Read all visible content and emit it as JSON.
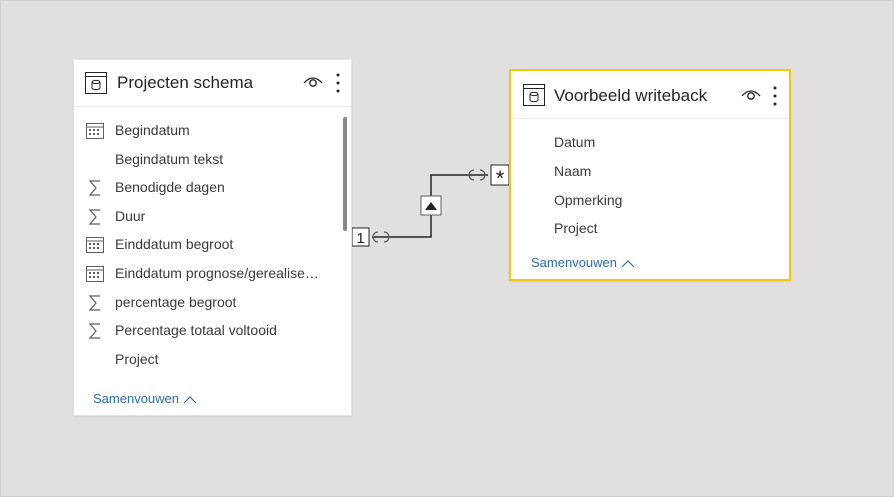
{
  "left_table": {
    "title": "Projecten schema",
    "fields": [
      {
        "label": "Begindatum",
        "icon": "calendar-icon"
      },
      {
        "label": "Begindatum tekst",
        "icon": ""
      },
      {
        "label": "Benodigde dagen",
        "icon": "sigma-icon"
      },
      {
        "label": "Duur",
        "icon": "sigma-icon"
      },
      {
        "label": "Einddatum begroot",
        "icon": "calendar-icon"
      },
      {
        "label": "Einddatum prognose/gerealise…",
        "icon": "calendar-icon"
      },
      {
        "label": "percentage begroot",
        "icon": "sigma-icon"
      },
      {
        "label": "Percentage totaal voltooid",
        "icon": "sigma-icon"
      },
      {
        "label": "Project",
        "icon": ""
      }
    ],
    "collapse_label": "Samenvouwen"
  },
  "right_table": {
    "title": "Voorbeeld writeback",
    "fields": [
      {
        "label": "Datum"
      },
      {
        "label": "Naam"
      },
      {
        "label": "Opmerking"
      },
      {
        "label": "Project"
      }
    ],
    "collapse_label": "Samenvouwen"
  },
  "relationship": {
    "one_side_label": "1",
    "many_side_label": "*",
    "filter_direction": "single"
  },
  "colors": {
    "canvas": "#e1e0de",
    "selected_border": "#f2c811",
    "link": "#2b6cb0"
  }
}
